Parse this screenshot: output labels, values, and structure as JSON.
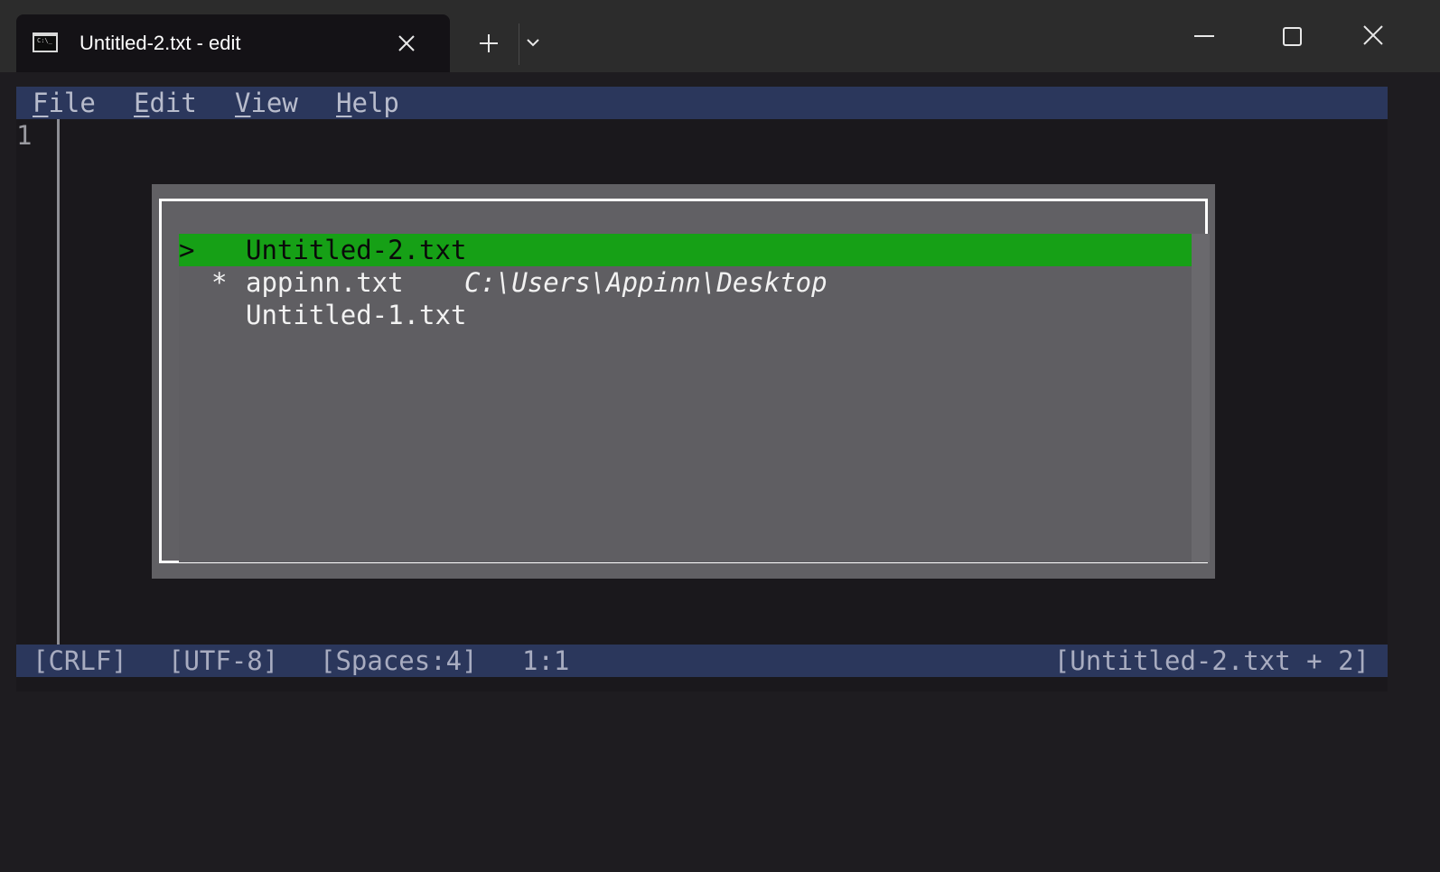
{
  "window": {
    "tab_title": "Untitled-2.txt - edit",
    "tab_icon_glyph": "C:\\_",
    "icons": {
      "tab_close": "close-icon",
      "new_tab": "plus-icon",
      "tab_dropdown": "chevron-down-icon",
      "minimize": "minimize-icon",
      "maximize": "maximize-icon",
      "close": "close-icon"
    }
  },
  "menubar": {
    "items": [
      {
        "mnemonic": "F",
        "rest": "ile"
      },
      {
        "mnemonic": "E",
        "rest": "dit"
      },
      {
        "mnemonic": "V",
        "rest": "iew"
      },
      {
        "mnemonic": "H",
        "rest": "elp"
      }
    ]
  },
  "editor": {
    "line_numbers": [
      "1"
    ]
  },
  "file_switcher": {
    "files": [
      {
        "marker": ">",
        "modified": "",
        "name": "Untitled-2.txt",
        "path": "",
        "selected": true
      },
      {
        "marker": "",
        "modified": "*",
        "name": "appinn.txt",
        "path": "C:\\Users\\Appinn\\Desktop",
        "selected": false
      },
      {
        "marker": "",
        "modified": "",
        "name": "Untitled-1.txt",
        "path": "",
        "selected": false
      }
    ]
  },
  "statusbar": {
    "eol": "[CRLF]",
    "encoding": "[UTF-8]",
    "indent": "[Spaces:4]",
    "position": "1:1",
    "document": "[Untitled-2.txt + 2]"
  },
  "colors": {
    "menubar_bg": "#2b375c",
    "selection_green": "#16a016",
    "dialog_bg": "#616064",
    "terminal_bg": "#1a181c"
  }
}
